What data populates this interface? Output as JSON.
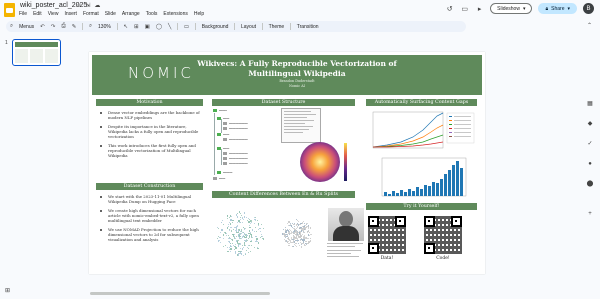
{
  "app": {
    "doc_title": "wiki_poster_acl_2025",
    "menu": [
      "File",
      "Edit",
      "View",
      "Insert",
      "Format",
      "Slide",
      "Arrange",
      "Tools",
      "Extensions",
      "Help"
    ],
    "slideshow_label": "Slideshow",
    "share_label": "Share",
    "avatar_letter": "B"
  },
  "toolbar": {
    "search_label": "Menus",
    "zoom": "130%",
    "background_label": "Background",
    "layout_label": "Layout",
    "theme_label": "Theme",
    "transition_label": "Transition"
  },
  "filmstrip": {
    "slide_number": "1"
  },
  "poster": {
    "logo": "NOMIC",
    "title": "Wikivecs: A Fully Reproducible Vectorization of Multilingual Wikipedia",
    "authors": "Brandon Duderstadt",
    "affiliation": "Nomic AI",
    "motivation": {
      "heading": "Motivation",
      "bullets": [
        "Dense vector embeddings are the backbone of modern NLP pipelines",
        "Despite its importance in the literature, Wikipedia lacks a fully open and reproducible vectorization",
        "This work introduces the first fully open and reproducible vectorization of Multilingual Wikipedia"
      ]
    },
    "construction": {
      "heading": "Dataset Construction",
      "bullets": [
        "We start with the 2023-11-01 Multilingual Wikipedia Dump on Hugging Face",
        "We create high dimensional vectors for each article with nomic-embed-text-v2, a fully open multilingual text embedder",
        "We use NOMAD Projection to reduce the high dimensional vectors to 2d for subsequent visualization and analysis"
      ]
    },
    "structure": {
      "heading": "Dataset Structure"
    },
    "gaps": {
      "heading": "Automatically Surfacing Content Gaps"
    },
    "differences": {
      "heading": "Content Differences Between En & Ru Splits"
    },
    "try": {
      "heading": "Try it Yourself!",
      "data_label": "Data!",
      "code_label": "Code!"
    }
  },
  "icons": {
    "star": "star-icon",
    "move": "folder-move-icon",
    "cloud": "cloud-icon",
    "history": "history-icon",
    "comment": "comment-icon",
    "video": "video-call-icon"
  }
}
